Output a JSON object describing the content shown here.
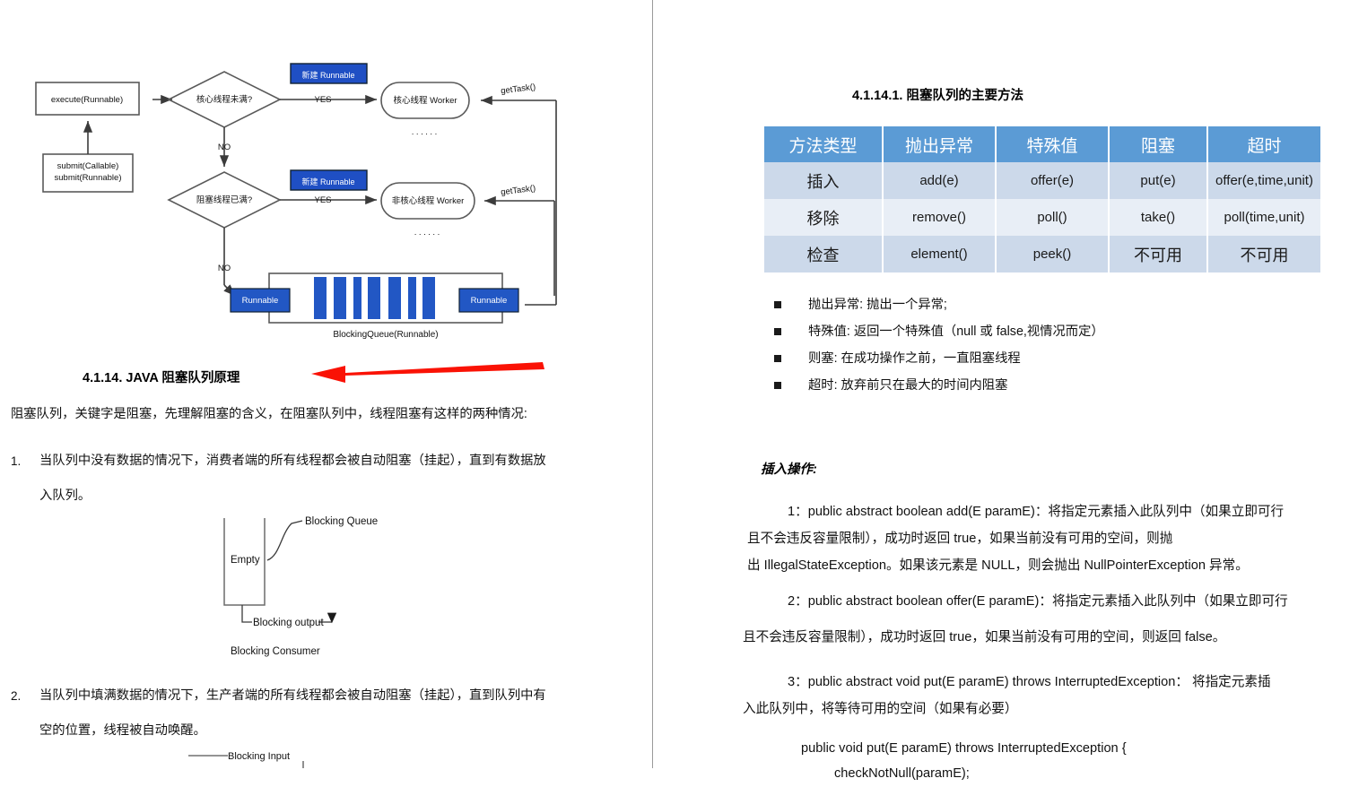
{
  "document": {
    "left_column": {
      "flowchart": {
        "title_alt": "JAVA thread pool execution flow",
        "nodes": {
          "execute": "execute(Runnable)",
          "submit_line1": "submit(Callable)",
          "submit_line2": "submit(Runnable)",
          "decision1": "核心线程未满?",
          "decision2": "阻塞线程已满?",
          "new_runnable_1": "新建 Runnable",
          "new_runnable_2": "新建 Runnable",
          "worker_core": "核心线程 Worker",
          "worker_noncore": "非核心线程 Worker",
          "queue_left": "Runnable",
          "queue_right": "Runnable",
          "queue_caption": "BlockingQueue(Runnable)",
          "dots_1": "· · · · · ·",
          "dots_2": "· · · · · ·"
        },
        "edge_labels": {
          "yes_1": "YES",
          "yes_2": "YES",
          "no_1": "NO",
          "no_2": "NO",
          "get_task_1": "getTask()",
          "get_task_2": "getTask()"
        },
        "colors": {
          "runnable_blue": "#1f4fc4",
          "queue_bar_blue": "#2257c4",
          "stroke": "#3b3b3b"
        }
      },
      "heading": "4.1.14.    JAVA 阻塞队列原理",
      "intro_paragraph": "阻塞队列，关键字是阻塞，先理解阻塞的含义，在阻塞队列中，线程阻塞有这样的两种情况:",
      "list": [
        {
          "number": "1.",
          "line1": "当队列中没有数据的情况下，消费者端的所有线程都会被自动阻塞（挂起），直到有数据放",
          "line2": "入队列。"
        },
        {
          "number": "2.",
          "line1": "当队列中填满数据的情况下，生产者端的所有线程都会被自动阻塞（挂起），直到队列中有",
          "line2": "空的位置，线程被自动唤醒。"
        }
      ],
      "consumer_diagram": {
        "empty_label": "Empty",
        "queue_label": "Blocking Queue",
        "output_label": "Blocking output",
        "caption": "Blocking Consumer"
      },
      "producer_diagram": {
        "input_label": "Blocking Input"
      },
      "red_arrow_color": "#fa1205"
    },
    "right_column": {
      "heading": "4.1.14.1.   阻塞队列的主要方法",
      "table": {
        "headers": [
          "方法类型",
          "抛出异常",
          "特殊值",
          "阻塞",
          "超时"
        ],
        "rows": [
          [
            "插入",
            "add(e)",
            "offer(e)",
            "put(e)",
            "offer(e,time,unit)"
          ],
          [
            "移除",
            "remove()",
            "poll()",
            "take()",
            "poll(time,unit)"
          ],
          [
            "检查",
            "element()",
            "peek()",
            "不可用",
            "不可用"
          ]
        ],
        "header_color": "#5b9bd5",
        "row_odd_color": "#ccd9ea",
        "row_even_color": "#e8eef6"
      },
      "bullets": [
        "抛出异常: 抛出一个异常;",
        "特殊值: 返回一个特殊值（null 或 false,视情况而定）",
        "则塞: 在成功操作之前，一直阻塞线程",
        "超时: 放弃前只在最大的时间内阻塞"
      ],
      "insert_section_title": "插入操作:",
      "method_1": {
        "line1": "1：public abstract boolean add(E paramE)：将指定元素插入此队列中（如果立即可行",
        "line2": "且不会违反容量限制），成功时返回 true，如果当前没有可用的空间，则抛",
        "line3": "出 IllegalStateException。如果该元素是 NULL，则会抛出 NullPointerException 异常。"
      },
      "method_2": {
        "line1": "2：public abstract boolean offer(E paramE)：将指定元素插入此队列中（如果立即可行",
        "line2": "且不会违反容量限制），成功时返回 true，如果当前没有可用的空间，则返回 false。"
      },
      "method_3": {
        "line1": "3：public abstract void put(E paramE) throws InterruptedException：  将指定元素插",
        "line2": "入此队列中，将等待可用的空间（如果有必要）"
      },
      "code_block": {
        "line1": "public void put(E paramE) throws InterruptedException {",
        "line2": "checkNotNull(paramE);"
      }
    }
  }
}
